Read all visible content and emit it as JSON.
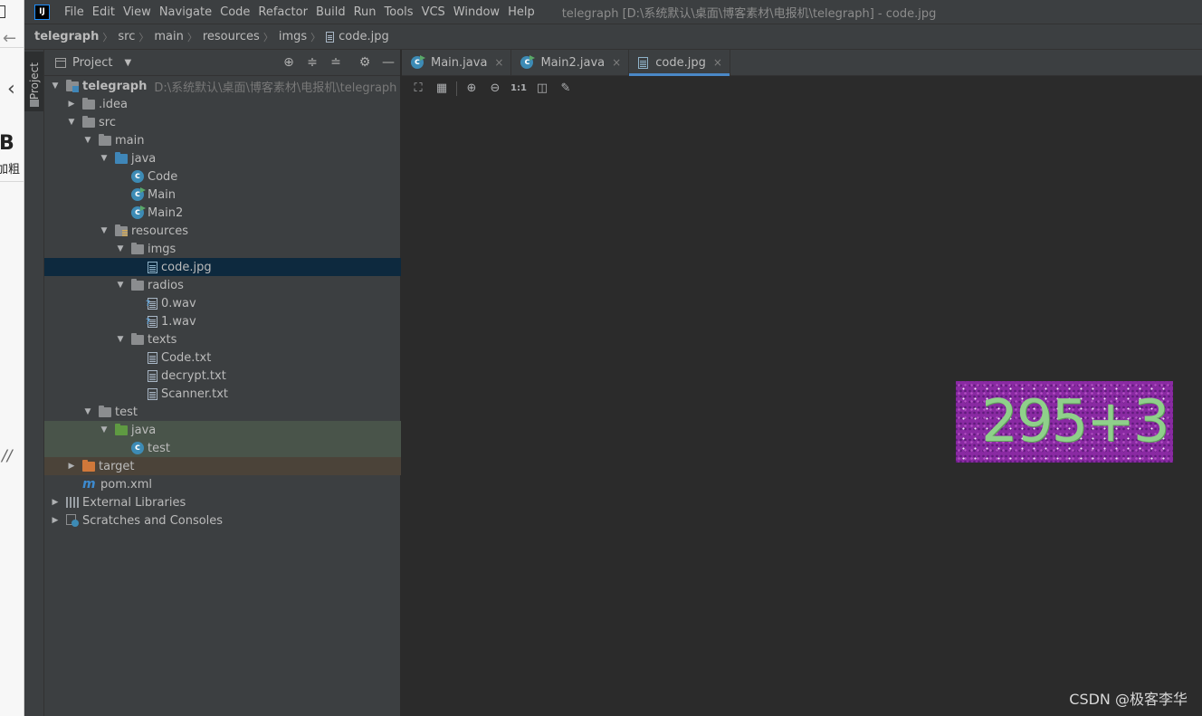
{
  "menu": {
    "app_logo": "IJ",
    "items": [
      "File",
      "Edit",
      "View",
      "Navigate",
      "Code",
      "Refactor",
      "Build",
      "Run",
      "Tools",
      "VCS",
      "Window",
      "Help"
    ],
    "window_title": "telegraph [D:\\系统默认\\桌面\\博客素材\\电报机\\telegraph] - code.jpg"
  },
  "browser_strip": {
    "bold_letter": "B",
    "bold_label": "加粗",
    "slashes": "//"
  },
  "breadcrumb": [
    "telegraph",
    "src",
    "main",
    "resources",
    "imgs",
    "code.jpg"
  ],
  "tool_stripe": {
    "project_label": "Project"
  },
  "project_panel": {
    "title": "Project",
    "tree": [
      {
        "label": "telegraph",
        "path": "D:\\系统默认\\桌面\\博客素材\\电报机\\telegraph",
        "icon": "module-folder-icon",
        "depth": 0,
        "arrow": "down"
      },
      {
        "label": ".idea",
        "icon": "folder-icon",
        "depth": 1,
        "arrow": "right"
      },
      {
        "label": "src",
        "icon": "folder-icon",
        "depth": 1,
        "arrow": "down"
      },
      {
        "label": "main",
        "icon": "folder-icon",
        "depth": 2,
        "arrow": "down"
      },
      {
        "label": "java",
        "icon": "source-folder-icon",
        "depth": 3,
        "arrow": "down"
      },
      {
        "label": "Code",
        "icon": "class-icon",
        "depth": 4,
        "arrow": ""
      },
      {
        "label": "Main",
        "icon": "runnable-class-icon",
        "depth": 4,
        "arrow": ""
      },
      {
        "label": "Main2",
        "icon": "runnable-class-icon",
        "depth": 4,
        "arrow": ""
      },
      {
        "label": "resources",
        "icon": "resources-folder-icon",
        "depth": 3,
        "arrow": "down"
      },
      {
        "label": "imgs",
        "icon": "folder-icon",
        "depth": 4,
        "arrow": "down"
      },
      {
        "label": "code.jpg",
        "icon": "image-file-icon",
        "depth": 5,
        "arrow": "",
        "selected": true
      },
      {
        "label": "radios",
        "icon": "folder-icon",
        "depth": 4,
        "arrow": "down"
      },
      {
        "label": "0.wav",
        "icon": "unknown-file-icon",
        "depth": 5,
        "arrow": ""
      },
      {
        "label": "1.wav",
        "icon": "unknown-file-icon",
        "depth": 5,
        "arrow": ""
      },
      {
        "label": "texts",
        "icon": "folder-icon",
        "depth": 4,
        "arrow": "down"
      },
      {
        "label": "Code.txt",
        "icon": "text-file-icon",
        "depth": 5,
        "arrow": ""
      },
      {
        "label": "decrypt.txt",
        "icon": "text-file-icon",
        "depth": 5,
        "arrow": ""
      },
      {
        "label": "Scanner.txt",
        "icon": "text-file-icon",
        "depth": 5,
        "arrow": ""
      },
      {
        "label": "test",
        "icon": "folder-icon",
        "depth": 2,
        "arrow": "down"
      },
      {
        "label": "java",
        "icon": "test-folder-icon",
        "depth": 3,
        "arrow": "down",
        "bg": "test"
      },
      {
        "label": "test",
        "icon": "class-icon",
        "depth": 4,
        "arrow": "",
        "bg": "test"
      },
      {
        "label": "target",
        "icon": "excluded-folder-icon",
        "depth": 1,
        "arrow": "right",
        "bg": "excluded"
      },
      {
        "label": "pom.xml",
        "icon": "maven-icon",
        "depth": 1,
        "arrow": ""
      },
      {
        "label": "External Libraries",
        "icon": "libraries-icon",
        "depth": 0,
        "arrow": "right"
      },
      {
        "label": "Scratches and Consoles",
        "icon": "scratches-icon",
        "depth": 0,
        "arrow": "right"
      }
    ]
  },
  "editor_tabs": [
    {
      "label": "Main.java",
      "icon": "runnable-class-icon",
      "active": false
    },
    {
      "label": "Main2.java",
      "icon": "runnable-class-icon",
      "active": false
    },
    {
      "label": "code.jpg",
      "icon": "image-file-icon",
      "active": true
    }
  ],
  "viewer_toolbar": [
    "fit-zoom-icon",
    "grid-icon",
    "zoom-in-icon",
    "zoom-out-icon",
    "actual-size-icon",
    "background-icon",
    "color-picker-icon"
  ],
  "viewer": {
    "captcha_text": "295+3",
    "captcha_bg": "#8a2aa3",
    "captcha_fg": "#8fd08a"
  },
  "watermark": "CSDN @极客李华",
  "colors": {
    "accent": "#4a88c7",
    "selection": "#0d293e",
    "panel_bg": "#3c3f41",
    "editor_bg": "#2b2b2b"
  }
}
